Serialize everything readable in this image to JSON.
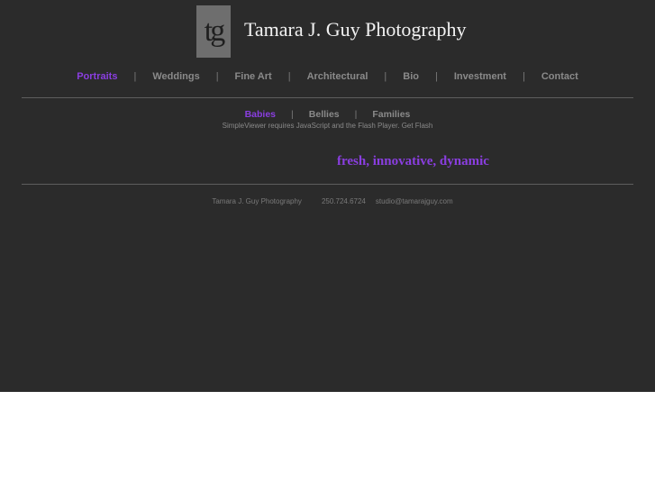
{
  "header": {
    "logo_text": "tg",
    "title": "Tamara J. Guy Photography"
  },
  "main_nav": {
    "items": [
      {
        "label": "Portraits",
        "active": true
      },
      {
        "label": "Weddings"
      },
      {
        "label": "Fine Art"
      },
      {
        "label": "Architectural"
      },
      {
        "label": "Bio"
      },
      {
        "label": "Investment"
      },
      {
        "label": "Contact"
      }
    ],
    "separator": "|"
  },
  "sub_nav": {
    "items": [
      {
        "label": "Babies",
        "active": true
      },
      {
        "label": "Bellies"
      },
      {
        "label": "Families"
      }
    ],
    "separator": "|"
  },
  "flash_note": {
    "text": "SimpleViewer requires JavaScript and the Flash Player.",
    "link": "Get Flash"
  },
  "tagline": "fresh, innovative, dynamic",
  "footer": {
    "name": "Tamara J. Guy Photography",
    "phone": "250.724.6724",
    "email": "studio@tamarajguy.com"
  },
  "colors": {
    "background": "#2b2b2b",
    "accent": "#8a3ee0",
    "link": "#8a8a8a"
  }
}
